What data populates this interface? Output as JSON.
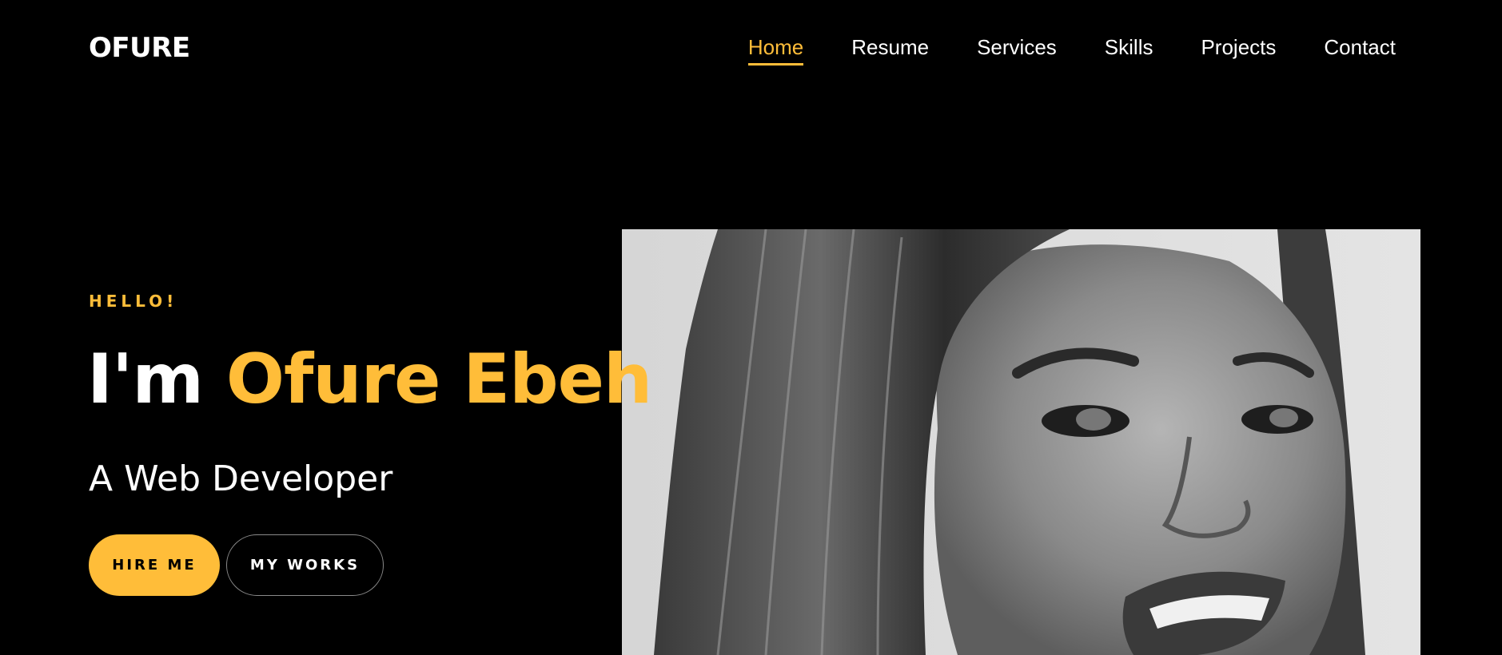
{
  "brand": {
    "logo": "OFURE"
  },
  "nav": {
    "items": [
      {
        "label": "Home",
        "active": true
      },
      {
        "label": "Resume",
        "active": false
      },
      {
        "label": "Services",
        "active": false
      },
      {
        "label": "Skills",
        "active": false
      },
      {
        "label": "Projects",
        "active": false
      },
      {
        "label": "Contact",
        "active": false
      }
    ]
  },
  "hero": {
    "greeting": "HELLO!",
    "intro": "I'm",
    "name": "Ofure Ebeh",
    "role": "A Web Developer",
    "hire_label": "HIRE ME",
    "works_label": "MY WORKS"
  },
  "colors": {
    "accent": "#ffbd39",
    "background": "#000000",
    "text": "#ffffff"
  }
}
